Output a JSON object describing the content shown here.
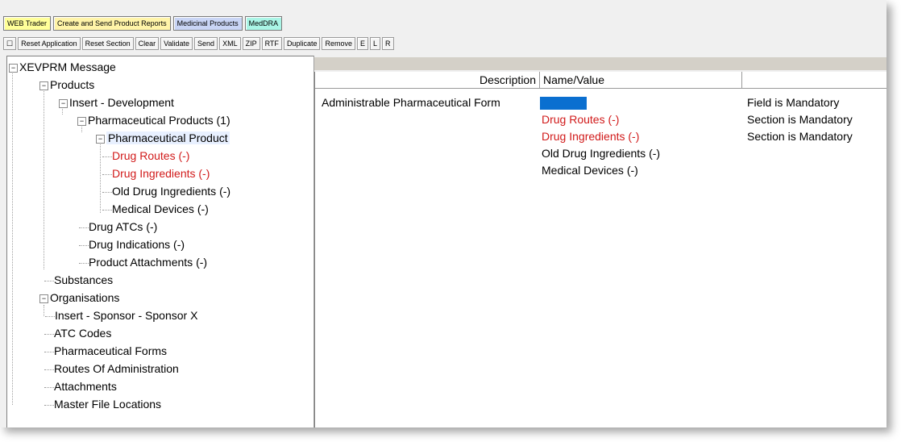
{
  "tabs": [
    "WEB Trader",
    "Create and Send Product Reports",
    "Medicinal Products",
    "MedDRA"
  ],
  "toolbar": [
    "☐",
    "Reset Application",
    "Reset Section",
    "Clear",
    "Validate",
    "Send",
    "XML",
    "ZIP",
    "RTF",
    "Duplicate",
    "Remove",
    "E",
    "L",
    "R"
  ],
  "tree": {
    "root": "XEVPRM Message",
    "products": "Products",
    "insert_dev": "Insert - Development",
    "pharm_products": "Pharmaceutical Products (1)",
    "pharm_product": "Pharmaceutical Product",
    "drug_routes": "Drug Routes (-)",
    "drug_ingredients": "Drug Ingredients (-)",
    "old_drug_ingredients": "Old Drug Ingredients (-)",
    "medical_devices": "Medical Devices (-)",
    "drug_atcs": "Drug ATCs (-)",
    "drug_indications": "Drug Indications (-)",
    "product_attachments": "Product Attachments (-)",
    "substances": "Substances",
    "organisations": "Organisations",
    "insert_sponsor": "Insert - Sponsor - Sponsor X",
    "atc_codes": "ATC Codes",
    "pharm_forms": "Pharmaceutical Forms",
    "routes_admin": "Routes Of Administration",
    "attachments": "Attachments",
    "master_file": "Master File Locations"
  },
  "grid": {
    "headers": {
      "description": "Description",
      "name_value": "Name/Value",
      "status": ""
    },
    "rows": [
      {
        "description": "Administrable Pharmaceutical Form",
        "value": "",
        "status": "Field is Mandatory"
      },
      {
        "description": "",
        "value": "Drug Routes (-)",
        "status": "Section is Mandatory"
      },
      {
        "description": "",
        "value": "Drug Ingredients (-)",
        "status": "Section is Mandatory"
      },
      {
        "description": "",
        "value": "Old Drug Ingredients (-)",
        "status": ""
      },
      {
        "description": "",
        "value": "Medical Devices (-)",
        "status": ""
      }
    ]
  },
  "colors": {
    "mandatory_red": "#d11a1a",
    "selected_blue": "#0a6fd0"
  }
}
